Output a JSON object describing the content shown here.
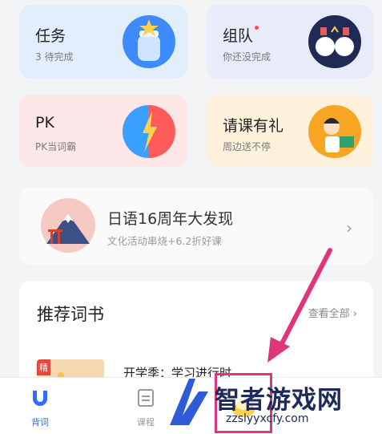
{
  "cards": {
    "task": {
      "title": "任务",
      "subtitle": "3 待完成"
    },
    "team": {
      "title": "组队",
      "subtitle": "你还没完成"
    },
    "pk": {
      "title": "PK",
      "subtitle": "PK当词霸"
    },
    "invite": {
      "title": "请课有礼",
      "subtitle": "周边送不停"
    }
  },
  "banner": {
    "title": "日语16周年大发现",
    "subtitle": "文化活动串烧+6.2折好课",
    "arrow": "›"
  },
  "recommend": {
    "title": "推荐词书",
    "more": "查看全部 ›",
    "book": {
      "tag": "精",
      "name": "开学季：学习进行时"
    }
  },
  "tabbar": {
    "tabs": [
      {
        "label": "背词"
      },
      {
        "label": "课程"
      }
    ]
  },
  "watermark": {
    "name": "智者游戏网",
    "url": "zzslyyxcfy.com"
  },
  "colors": {
    "accent": "#2f6bff",
    "highlight": "#e0357a"
  }
}
